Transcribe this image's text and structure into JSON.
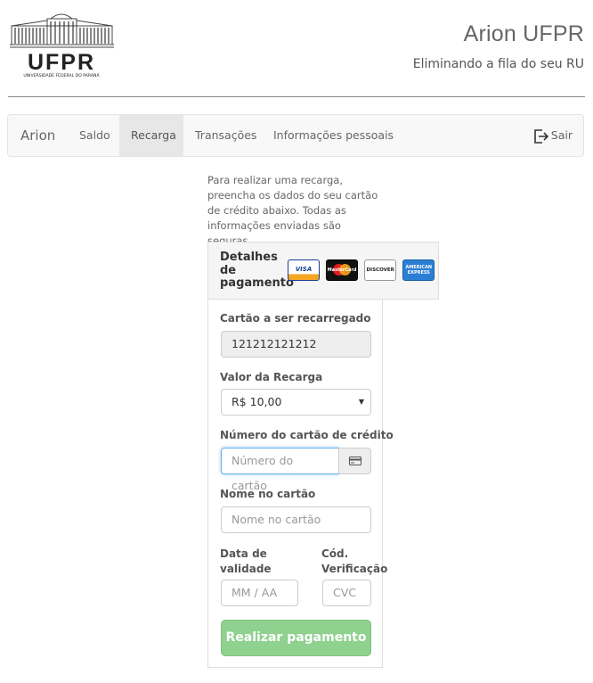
{
  "header": {
    "logo_text": "UFPR",
    "logo_subtext": "UNIVERSIDADE FEDERAL DO PARANÁ",
    "title": "Arion UFPR",
    "subtitle": "Eliminando a fila do seu RU"
  },
  "nav": {
    "brand": "Arion",
    "items": [
      {
        "label": "Saldo"
      },
      {
        "label": "Recarga",
        "active": true
      },
      {
        "label": "Transações"
      },
      {
        "label": "Informações pessoais"
      }
    ],
    "logout_label": "Sair",
    "logout_icon": "sign-out-icon"
  },
  "intro": "Para realizar uma recarga, preencha os dados do seu cartão de crédito abaixo. Todas as informações enviadas são seguras.",
  "panel": {
    "title": "Detalhes de pagamento",
    "cards": [
      "VISA",
      "MasterCard",
      "DISCOVER",
      "AMERICAN EXPRESS"
    ]
  },
  "form": {
    "card_label": "Cartão a ser recarregado",
    "card_value": "121212121212",
    "amount_label": "Valor da Recarga",
    "amount_value": "R$ 10,00",
    "number_label": "Número do cartão de crédito",
    "number_placeholder": "Número do cartão",
    "name_label": "Nome no cartão",
    "name_placeholder": "Nome no cartão",
    "expiry_label": "Data de validade",
    "expiry_placeholder": "MM / AA",
    "cvc_label": "Cód. Verificação",
    "cvc_placeholder": "CVC",
    "submit_label": "Realizar pagamento"
  },
  "colors": {
    "submit_bg": "#8fd18f",
    "active_tab_bg": "#e7e7e7",
    "focus_border": "#66afe9"
  }
}
